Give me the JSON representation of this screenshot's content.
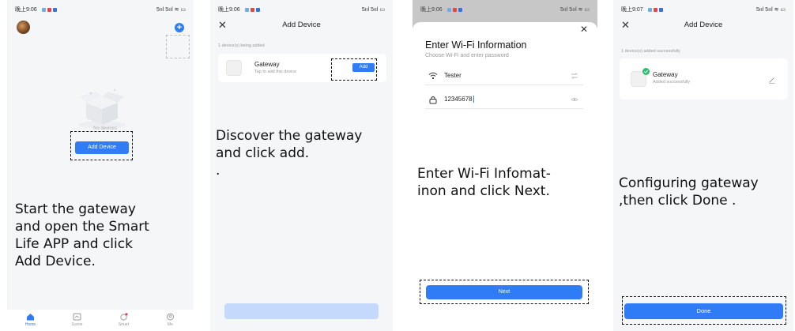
{
  "colors": {
    "accent": "#2f7cf6",
    "success": "#2dbd6e"
  },
  "status_bar": {
    "screen1": {
      "time": "晚上9:06",
      "signal": "5ııl 5ııl ≋ ▭"
    },
    "screen2": {
      "time": "晚上9:06",
      "signal": "5ııl 5ııl ▭"
    },
    "screen3": {
      "time": "晚上9:06",
      "signal": "5ııl 5ııl ≋ ▭"
    },
    "screen4": {
      "time": "晚上9:07",
      "signal": "5ııl 5ııl ≋ ▭"
    }
  },
  "screen1": {
    "add_device_button": "Add Device",
    "empty_text": "No devices",
    "caption": [
      "Start the gateway",
      "and open the Smart",
      "Life APP and click",
      "Add Device."
    ],
    "tabs": [
      {
        "label": "Home",
        "icon": "home-icon"
      },
      {
        "label": "Scene",
        "icon": "scene-icon"
      },
      {
        "label": "Smart",
        "icon": "smart-icon"
      },
      {
        "label": "Me",
        "icon": "me-icon"
      }
    ]
  },
  "screen2": {
    "close": "✕",
    "title": "Add Device",
    "section_label": "1 device(s) being added",
    "device_name": "Gateway",
    "device_sub": "Tap to add this device",
    "add_button": "Add",
    "caption": [
      "Discover the gateway",
      "and click add.",
      "."
    ]
  },
  "screen3": {
    "close": "✕",
    "title": "Enter Wi-Fi Information",
    "subtitle": "Choose Wi-Fi and enter password",
    "wifi_name": "Tester",
    "password": "12345678",
    "next_button": "Next",
    "caption": [
      "Enter Wi-Fi Infomat-",
      "inon and click Next."
    ]
  },
  "screen4": {
    "close": "✕",
    "title": "Add Device",
    "section_label": "1 device(s) added successfully",
    "device_name": "Gateway",
    "device_sub": "Added successfully",
    "done_button": "Done",
    "caption": [
      "Configuring gateway",
      ",then click Done ."
    ]
  }
}
